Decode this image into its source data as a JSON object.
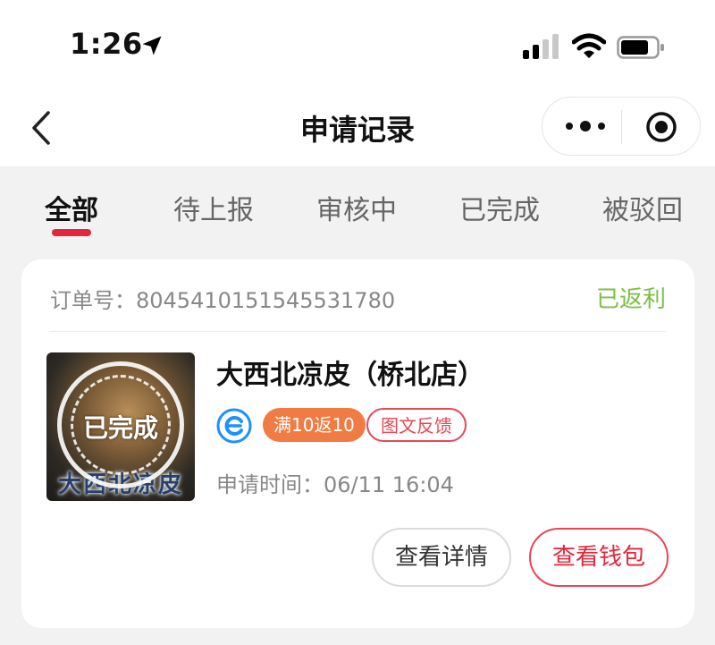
{
  "status_bar": {
    "time": "1:26",
    "icons": [
      "location-arrow-icon",
      "signal-icon",
      "wifi-icon",
      "battery-icon"
    ]
  },
  "nav": {
    "title": "申请记录",
    "back_icon": "chevron-left-icon",
    "menu_icon": "more-dots-icon",
    "close_icon": "target-circle-icon"
  },
  "tabs": [
    {
      "label": "全部",
      "active": true
    },
    {
      "label": "待上报",
      "active": false
    },
    {
      "label": "审核中",
      "active": false
    },
    {
      "label": "已完成",
      "active": false
    },
    {
      "label": "被驳回",
      "active": false
    }
  ],
  "card": {
    "order_no": "订单号：8045410151545531780",
    "status": "已返利",
    "thumbnail": {
      "stamp": "已完成",
      "caption": "大西北凉皮"
    },
    "shop_name": "大西北凉皮（桥北店）",
    "platform_icon": "eleme-icon",
    "promo_badge": "满10返10",
    "feedback_badge": "图文反馈",
    "apply_time": "申请时间：06/11 16:04",
    "buttons": {
      "detail": "查看详情",
      "wallet": "查看钱包"
    }
  },
  "colors": {
    "accent_red": "#e3263b",
    "status_green": "#7bc043",
    "promo_orange": "#f07b43"
  }
}
